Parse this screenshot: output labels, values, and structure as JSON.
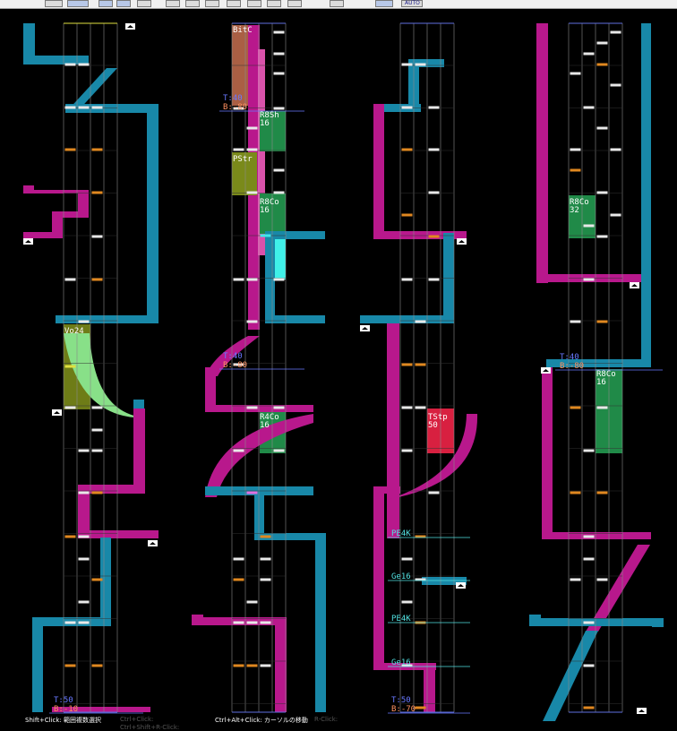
{
  "toolbar": {
    "buttons": [
      {
        "name": "toolbar-undo-button",
        "active": false
      },
      {
        "name": "toolbar-zoom-button",
        "active": true
      },
      {
        "name": "toolbar-view-button",
        "active": true
      },
      {
        "name": "toolbar-select-button",
        "active": true
      },
      {
        "name": "toolbar-pen-button",
        "active": false
      },
      {
        "name": "toolbar-erase-button",
        "active": false
      },
      {
        "name": "toolbar-note-button",
        "active": false
      },
      {
        "name": "toolbar-long-button",
        "active": false
      },
      {
        "name": "toolbar-save-button",
        "active": false
      },
      {
        "name": "toolbar-play-button",
        "active": false
      },
      {
        "name": "toolbar-record-button",
        "active": false
      },
      {
        "name": "toolbar-settings-button",
        "active": false
      },
      {
        "name": "toolbar-preview-button",
        "active": false
      },
      {
        "name": "toolbar-scroll-button",
        "active": true
      },
      {
        "name": "toolbar-auto-button",
        "active": false
      }
    ],
    "auto_label": "AUTO"
  },
  "colors": {
    "pink": "#b8188c",
    "teal": "#1888a8",
    "orange": "#e08820",
    "white_note": "#e8e8e8",
    "lane_line": "#8a8a8a",
    "green": "#208a48",
    "olive": "#7a8a1a",
    "red": "#d82040",
    "cyan_note": "#40e8e8",
    "salmon": "#c87050",
    "lightcyan_text": "#50e0e0",
    "bpm_blue": "#6878ff",
    "beat_orange": "#ff9060"
  },
  "lane_labels": [
    {
      "text": "BitC"
    },
    {
      "text": "R8Sh\n16"
    },
    {
      "text": "PStr"
    },
    {
      "text": "R8Co\n16"
    },
    {
      "text": "Vo24"
    },
    {
      "text": "R4Co\n16"
    },
    {
      "text": "TStp\n50"
    },
    {
      "text": "R8Co\n32"
    },
    {
      "text": "R8Co\n16"
    }
  ],
  "tempo_markers": [
    {
      "tempo": "T:40",
      "beat": "B:-80"
    },
    {
      "tempo": "T:40",
      "beat": "B:-80"
    },
    {
      "tempo": "T:50",
      "beat": "B:-10"
    },
    {
      "tempo": "T:40",
      "beat": "B:-80"
    },
    {
      "tempo": "T:50",
      "beat": "B:-70"
    }
  ],
  "cyan_labels": [
    "PE4K",
    "Ge16",
    "PE4K",
    "Ge16"
  ],
  "hints": {
    "shift_click": "Shift+Click: 範囲複数選択",
    "ctrl_click": "Ctrl+Click:",
    "ctrl_shift_rclick": "Ctrl+Shift+R-Click:",
    "ctrl_alt_click": "Ctrl+Alt+Click: カーソルの移動",
    "rclick": "R-Click:"
  }
}
